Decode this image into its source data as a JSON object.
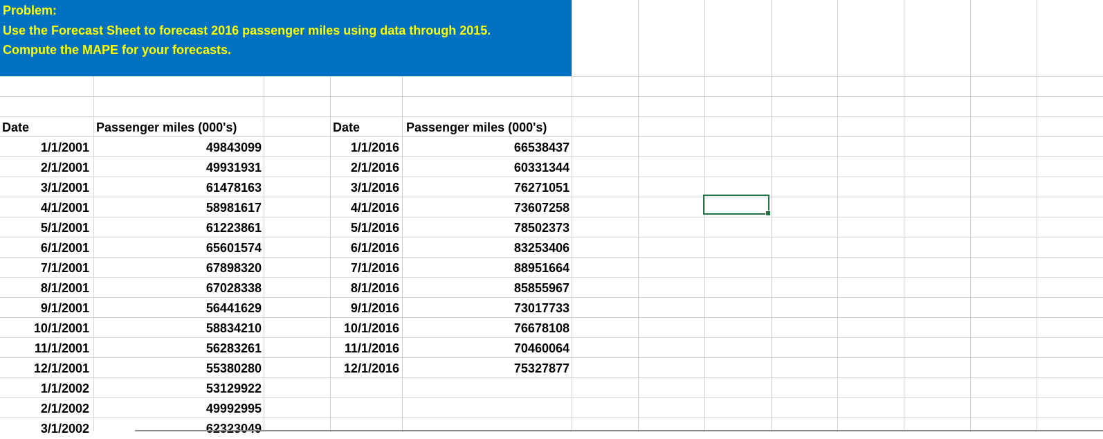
{
  "problem": {
    "line1": "Problem:",
    "line2": "Use the Forecast Sheet to forecast 2016 passenger miles using data through 2015.",
    "line3": "Compute the MAPE for your forecasts."
  },
  "colors": {
    "problem_fill": "#0070c0",
    "problem_text": "#ffff00",
    "selection": "#217346",
    "gridline": "#d4d4d4"
  },
  "table1": {
    "header_date": "Date",
    "header_miles": "Passenger miles (000's)",
    "rows": [
      {
        "date": "1/1/2001",
        "miles": "49843099"
      },
      {
        "date": "2/1/2001",
        "miles": "49931931"
      },
      {
        "date": "3/1/2001",
        "miles": "61478163"
      },
      {
        "date": "4/1/2001",
        "miles": "58981617"
      },
      {
        "date": "5/1/2001",
        "miles": "61223861"
      },
      {
        "date": "6/1/2001",
        "miles": "65601574"
      },
      {
        "date": "7/1/2001",
        "miles": "67898320"
      },
      {
        "date": "8/1/2001",
        "miles": "67028338"
      },
      {
        "date": "9/1/2001",
        "miles": "56441629"
      },
      {
        "date": "10/1/2001",
        "miles": "58834210"
      },
      {
        "date": "11/1/2001",
        "miles": "56283261"
      },
      {
        "date": "12/1/2001",
        "miles": "55380280"
      },
      {
        "date": "1/1/2002",
        "miles": "53129922"
      },
      {
        "date": "2/1/2002",
        "miles": "49992995"
      },
      {
        "date": "3/1/2002",
        "miles": "62323049"
      }
    ]
  },
  "table2": {
    "header_date": "Date",
    "header_miles": "Passenger miles (000's)",
    "rows": [
      {
        "date": "1/1/2016",
        "miles": "66538437"
      },
      {
        "date": "2/1/2016",
        "miles": "60331344"
      },
      {
        "date": "3/1/2016",
        "miles": "76271051"
      },
      {
        "date": "4/1/2016",
        "miles": "73607258"
      },
      {
        "date": "5/1/2016",
        "miles": "78502373"
      },
      {
        "date": "6/1/2016",
        "miles": "83253406"
      },
      {
        "date": "7/1/2016",
        "miles": "88951664"
      },
      {
        "date": "8/1/2016",
        "miles": "85855967"
      },
      {
        "date": "9/1/2016",
        "miles": "73017733"
      },
      {
        "date": "10/1/2016",
        "miles": "76678108"
      },
      {
        "date": "11/1/2016",
        "miles": "70460064"
      },
      {
        "date": "12/1/2016",
        "miles": "75327877"
      }
    ]
  }
}
